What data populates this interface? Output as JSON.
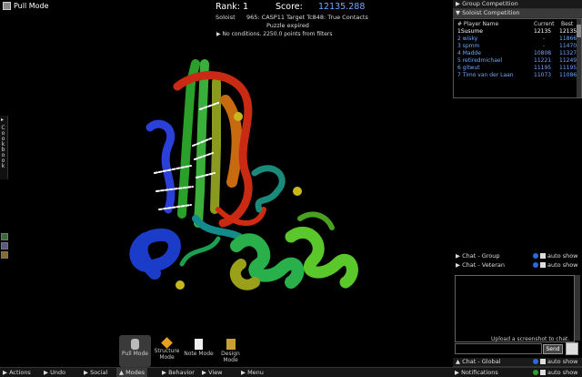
{
  "viewport": {
    "mode_label": "Pull Mode"
  },
  "score_panel": {
    "rank_label": "Rank: 1",
    "score_label": "Score:",
    "score_value": "12135.288",
    "soloist_label": "Soloist",
    "puzzle_title": "965: CASP11 Target Tc848: True Contacts",
    "puzzle_status": "Puzzle expired",
    "conditions": "No conditions. 2250.0 points from filters"
  },
  "cookbook": {
    "label": "Cookbook"
  },
  "right_panel": {
    "group_competition": "Group Competition",
    "soloist_competition": "Soloist Competition",
    "table": {
      "headers": [
        "# Player Name",
        "Current",
        "Best"
      ],
      "rows": [
        [
          "1Susume",
          "12135",
          "12135"
        ],
        [
          "2 wisky",
          "-",
          "11866"
        ],
        [
          "3 spmm",
          "-",
          "11470"
        ],
        [
          "4 Madde",
          "10808",
          "11327"
        ],
        [
          "5 retiredmichael",
          "11221",
          "11249"
        ],
        [
          "6 gitwut",
          "11195",
          "11195"
        ],
        [
          "7 Timo van der Laan",
          "11073",
          "11086"
        ]
      ]
    },
    "chat_group": "Chat - Group",
    "chat_veteran": "Chat - Veteran",
    "auto_show": "auto show",
    "upload_hint": "Upload a screenshot to chat.",
    "send_label": "Send",
    "chat_global": "Chat - Global",
    "notifications": "Notifications"
  },
  "modes": [
    {
      "label": "Pull Mode"
    },
    {
      "label": "Structure Mode"
    },
    {
      "label": "Note Mode"
    },
    {
      "label": "Design Mode"
    }
  ],
  "bottom_bar": {
    "actions": "Actions",
    "undo": "Undo",
    "social": "Social",
    "modes": "Modes",
    "behavior": "Behavior",
    "view": "View",
    "menu": "Menu"
  }
}
